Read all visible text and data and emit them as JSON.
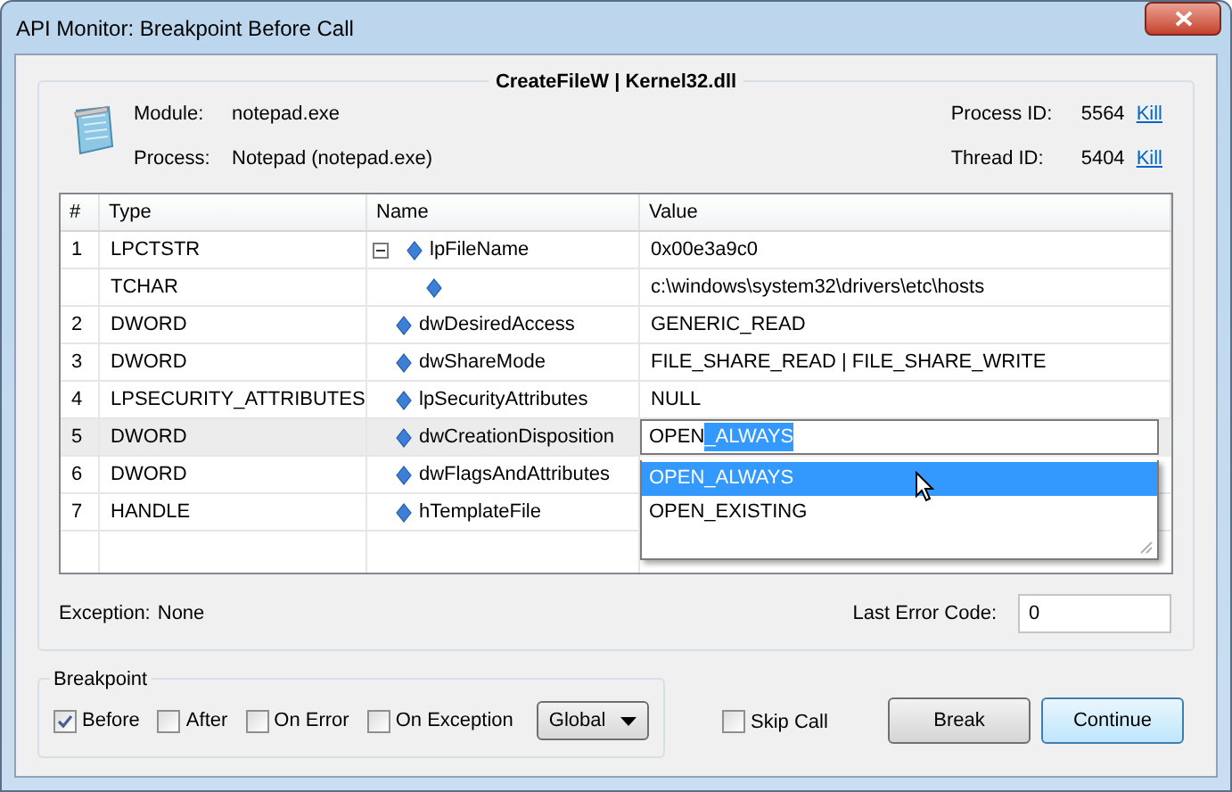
{
  "window": {
    "title": "API Monitor: Breakpoint Before Call"
  },
  "call": {
    "title": "CreateFileW | Kernel32.dll",
    "fields": [
      {
        "label": "Module:",
        "value": "notepad.exe"
      },
      {
        "label": "Process:",
        "value": "Notepad (notepad.exe)"
      }
    ],
    "ids": [
      {
        "label": "Process ID:",
        "value": "5564",
        "link": "Kill"
      },
      {
        "label": "Thread ID:",
        "value": "5404",
        "link": "Kill"
      }
    ]
  },
  "table": {
    "columns": [
      "#",
      "Type",
      "Name",
      "Value"
    ],
    "rows": [
      {
        "index": "1",
        "type": "LPCTSTR",
        "name": "lpFileName",
        "value": "0x00e3a9c0",
        "selected": false,
        "expanded": true,
        "children": [
          {
            "type": "TCHAR",
            "value": "c:\\windows\\system32\\drivers\\etc\\hosts",
            "selected": false
          }
        ]
      },
      {
        "index": "2",
        "type": "DWORD",
        "name": "dwDesiredAccess",
        "value": "GENERIC_READ",
        "selected": false
      },
      {
        "index": "3",
        "type": "DWORD",
        "name": "dwShareMode",
        "value": "FILE_SHARE_READ | FILE_SHARE_WRITE",
        "selected": false
      },
      {
        "index": "4",
        "type": "LPSECURITY_ATTRIBUTES",
        "name": "lpSecurityAttributes",
        "value": "NULL",
        "selected": false
      },
      {
        "index": "5",
        "type": "DWORD",
        "name": "dwCreationDisposition",
        "selected": true
      },
      {
        "index": "6",
        "type": "DWORD",
        "name": "dwFlagsAndAttributes",
        "selected": false
      },
      {
        "index": "7",
        "type": "HANDLE",
        "name": "hTemplateFile",
        "selected": false
      }
    ],
    "editor": {
      "text_parts": [
        {
          "text": "OPEN",
          "selected": false
        },
        {
          "text": "_ALWAYS",
          "selected": true
        }
      ],
      "options": [
        {
          "label": "OPEN_ALWAYS",
          "selected": true
        },
        {
          "label": "OPEN_EXISTING",
          "selected": false
        }
      ]
    }
  },
  "exception": {
    "label": "Exception:",
    "value": "None"
  },
  "last_error": {
    "label": "Last Error Code:",
    "value": "0"
  },
  "breakpoint": {
    "title": "Breakpoint",
    "options": [
      {
        "label": "Before",
        "checked": true
      },
      {
        "label": "After",
        "checked": false
      },
      {
        "label": "On Error",
        "checked": false
      },
      {
        "label": "On Exception",
        "checked": false
      }
    ],
    "scope": "Global"
  },
  "skip_call": {
    "label": "Skip Call",
    "checked": false
  },
  "buttons": [
    {
      "label": "Break",
      "default": false
    },
    {
      "label": "Continue",
      "default": true
    }
  ]
}
